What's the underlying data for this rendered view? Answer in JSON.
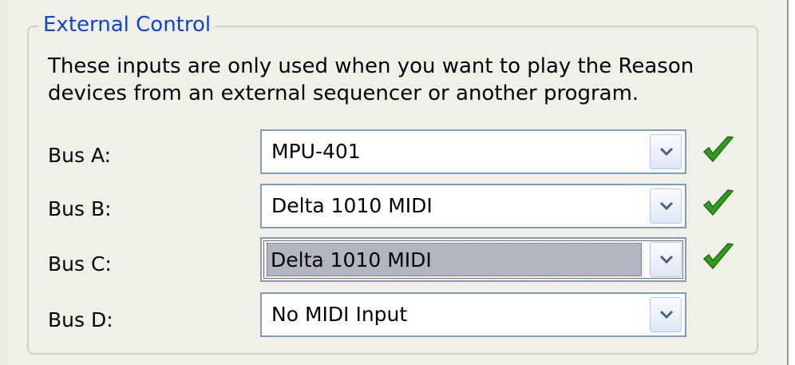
{
  "group": {
    "title": "External Control",
    "description": "These inputs are only used when you want to play the Reason devices from an external sequencer or another program."
  },
  "buses": [
    {
      "label": "Bus A:",
      "value": "MPU-401",
      "status_icon": "green-checkmark"
    },
    {
      "label": "Bus B:",
      "value": "Delta 1010 MIDI",
      "status_icon": "green-checkmark"
    },
    {
      "label": "Bus C:",
      "value": "Delta 1010 MIDI",
      "status_icon": "green-checkmark"
    },
    {
      "label": "Bus D:",
      "value": "No MIDI Input",
      "status_icon": ""
    }
  ],
  "colors": {
    "title": "#0b46d4",
    "checkmark": "#2f9e1c",
    "combo_border": "#7f9db9",
    "selection": "#b2b4bf"
  }
}
